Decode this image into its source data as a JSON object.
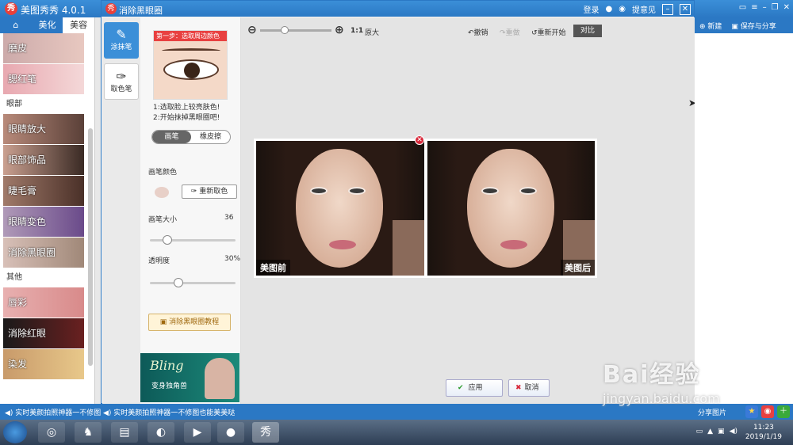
{
  "outer": {
    "app_title": "美图秀秀 4.0.1"
  },
  "left": {
    "tabs": [
      "美化",
      "美容"
    ],
    "section_eye": "眼部",
    "section_other": "其他",
    "items_top": [
      "磨皮",
      "腮红笔"
    ],
    "items_eye": [
      "眼睛放大",
      "眼部饰品",
      "睫毛膏",
      "眼睛变色",
      "消除黑眼圈"
    ],
    "items_other": [
      "唇彩",
      "消除红眼",
      "染发"
    ]
  },
  "dialog": {
    "title": "消除黑眼圈",
    "login": "登录",
    "feedback": "提意见",
    "tools": [
      {
        "label": "涂抹笔"
      },
      {
        "label": "取色笔"
      }
    ],
    "step_label": "第一步：选取周边颜色",
    "instructions": [
      "1:选取脸上较亮肤色!",
      "2:开始抹掉黑眼圈吧!"
    ],
    "mode_brush": "画笔",
    "mode_eraser": "橡皮擦",
    "brush_color_label": "画笔颜色",
    "repick_button": "重新取色",
    "brush_size_label": "画笔大小",
    "brush_size_value": "36",
    "opacity_label": "透明度",
    "opacity_value": "30%",
    "tutorial_button": "消除黑眼圈教程",
    "ad_title": "Bling",
    "ad_sub": "变身独角兽",
    "zoom_ratio": "1:1",
    "zoom_label": "原大",
    "undo": "撤销",
    "redo": "重做",
    "restart": "重新开始",
    "compare": "对比",
    "before_tag": "美图前",
    "after_tag": "美图后",
    "apply": "应用",
    "cancel": "取消"
  },
  "right": {
    "new_label": "新建",
    "save_share": "保存与分享"
  },
  "status": {
    "marquee_1": "实时美颜拍照神器一不修图",
    "marquee_2": "实时美颜拍照神器一不修图也能美美哒",
    "share_label": "分享图片"
  },
  "taskbar": {
    "time": "11:23",
    "date": "2019/1/19"
  },
  "watermark": {
    "big": "Bai经验",
    "small": "jingyan.baidu.com"
  }
}
